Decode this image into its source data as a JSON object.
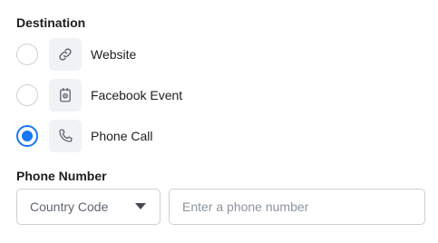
{
  "destination": {
    "title": "Destination",
    "options": [
      {
        "label": "Website",
        "icon": "link-icon",
        "selected": false
      },
      {
        "label": "Facebook Event",
        "icon": "event-icon",
        "selected": false
      },
      {
        "label": "Phone Call",
        "icon": "phone-icon",
        "selected": true
      }
    ]
  },
  "phone_number": {
    "title": "Phone Number",
    "country_code_value": "Country Code",
    "phone_placeholder": "Enter a phone number",
    "phone_value": ""
  },
  "colors": {
    "accent": "#1877f2",
    "border": "#ccd0d5",
    "icon_bg": "#f0f2f5"
  }
}
